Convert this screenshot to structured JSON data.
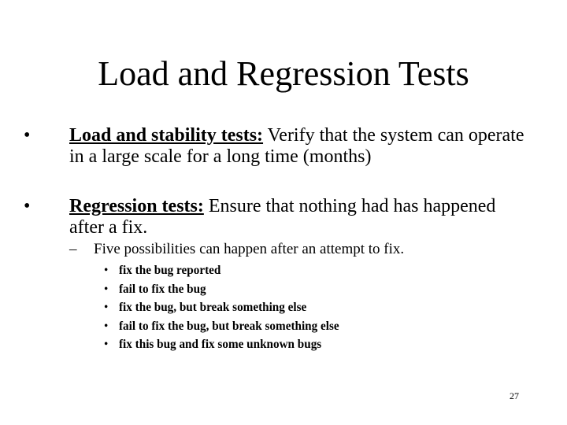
{
  "slide": {
    "title": "Load and Regression Tests",
    "bullets": [
      {
        "marker": "•",
        "term": "Load and stability tests:",
        "text": " Verify that the system can operate in a large scale for a long time (months)"
      },
      {
        "marker": "•",
        "term": "Regression tests:",
        "text": " Ensure that nothing had has happened after a fix."
      }
    ],
    "sub_bullet": {
      "marker": "–",
      "text": "Five possibilities can happen after an attempt to fix."
    },
    "possibilities": [
      {
        "marker": "•",
        "text": "fix the bug reported"
      },
      {
        "marker": "•",
        "text": "fail to fix the bug"
      },
      {
        "marker": "•",
        "text": "fix the bug, but break something else"
      },
      {
        "marker": "•",
        "text": "fail to fix the bug, but break something else"
      },
      {
        "marker": "•",
        "text": "fix this bug and fix some unknown bugs"
      }
    ],
    "page_number": "27"
  }
}
